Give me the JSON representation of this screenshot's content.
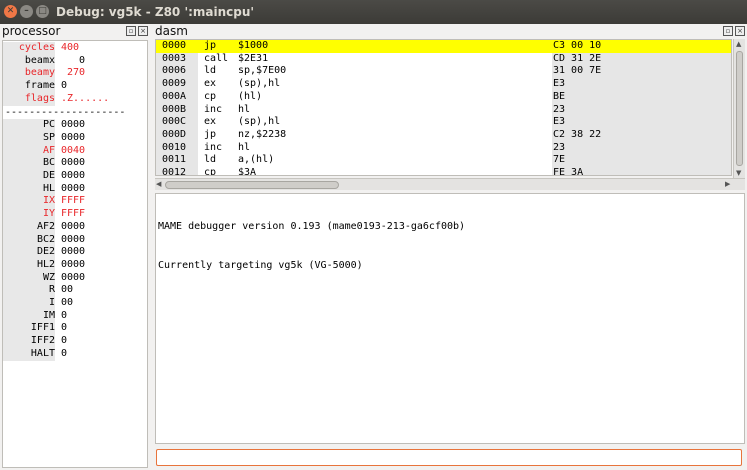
{
  "window": {
    "title": "Debug: vg5k - Z80 ':maincpu'"
  },
  "processor": {
    "title": "processor",
    "rows": [
      {
        "name": "cycles",
        "value": "400",
        "red": true
      },
      {
        "name": "beamx",
        "value": "   0",
        "red": false
      },
      {
        "name": "beamy",
        "value": " 270",
        "red": true
      },
      {
        "name": "frame",
        "value": "0",
        "red": false
      },
      {
        "name": "flags",
        "value": ".Z......",
        "red": true
      }
    ],
    "separator": "--------------------",
    "regs": [
      {
        "name": "PC",
        "value": "0000",
        "red": false
      },
      {
        "name": "SP",
        "value": "0000",
        "red": false
      },
      {
        "name": "AF",
        "value": "0040",
        "red": true
      },
      {
        "name": "BC",
        "value": "0000",
        "red": false
      },
      {
        "name": "DE",
        "value": "0000",
        "red": false
      },
      {
        "name": "HL",
        "value": "0000",
        "red": false
      },
      {
        "name": "IX",
        "value": "FFFF",
        "red": true
      },
      {
        "name": "IY",
        "value": "FFFF",
        "red": true
      },
      {
        "name": "AF2",
        "value": "0000",
        "red": false
      },
      {
        "name": "BC2",
        "value": "0000",
        "red": false
      },
      {
        "name": "DE2",
        "value": "0000",
        "red": false
      },
      {
        "name": "HL2",
        "value": "0000",
        "red": false
      },
      {
        "name": "WZ",
        "value": "0000",
        "red": false
      },
      {
        "name": "R",
        "value": "00",
        "red": false
      },
      {
        "name": "I",
        "value": "00",
        "red": false
      },
      {
        "name": "IM",
        "value": "0",
        "red": false
      },
      {
        "name": "IFF1",
        "value": "0",
        "red": false
      },
      {
        "name": "IFF2",
        "value": "0",
        "red": false
      },
      {
        "name": "HALT",
        "value": "0",
        "red": false
      }
    ]
  },
  "dasm": {
    "title": "dasm",
    "rows": [
      {
        "addr": "0000",
        "mn": "jp",
        "op": "$1000",
        "bytes": "C3 00 10"
      },
      {
        "addr": "0003",
        "mn": "call",
        "op": "$2E31",
        "bytes": "CD 31 2E"
      },
      {
        "addr": "0006",
        "mn": "ld",
        "op": "sp,$7E00",
        "bytes": "31 00 7E"
      },
      {
        "addr": "0009",
        "mn": "ex",
        "op": "(sp),hl",
        "bytes": "E3"
      },
      {
        "addr": "000A",
        "mn": "cp",
        "op": "(hl)",
        "bytes": "BE"
      },
      {
        "addr": "000B",
        "mn": "inc",
        "op": "hl",
        "bytes": "23"
      },
      {
        "addr": "000C",
        "mn": "ex",
        "op": "(sp),hl",
        "bytes": "E3"
      },
      {
        "addr": "000D",
        "mn": "jp",
        "op": "nz,$2238",
        "bytes": "C2 38 22"
      },
      {
        "addr": "0010",
        "mn": "inc",
        "op": "hl",
        "bytes": "23"
      },
      {
        "addr": "0011",
        "mn": "ld",
        "op": "a,(hl)",
        "bytes": "7E"
      },
      {
        "addr": "0012",
        "mn": "cp",
        "op": "$3A",
        "bytes": "FE 3A"
      }
    ]
  },
  "console": {
    "lines": [
      "MAME debugger version 0.193 (mame0193-213-ga6cf00b)",
      "Currently targeting vg5k (VG-5000)"
    ]
  },
  "command": {
    "value": ""
  }
}
